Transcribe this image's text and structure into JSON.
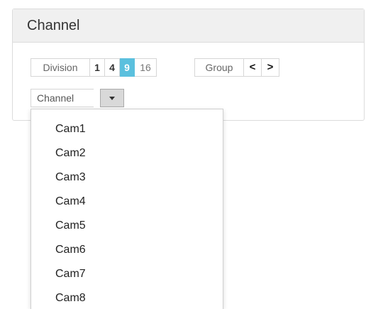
{
  "panel": {
    "title": "Channel"
  },
  "toolbar": {
    "division_label": "Division",
    "divisions": [
      {
        "label": "1",
        "active": false
      },
      {
        "label": "4",
        "active": false
      },
      {
        "label": "9",
        "active": true
      },
      {
        "label": "16",
        "active": false
      }
    ],
    "group_label": "Group",
    "prev_icon": "chevron-left-icon",
    "next_icon": "chevron-right-icon",
    "prev_glyph": "<",
    "next_glyph": ">"
  },
  "channel_select": {
    "label": "Channel",
    "caret_icon": "caret-down-icon"
  },
  "dropdown": {
    "items": [
      "Cam1",
      "Cam2",
      "Cam3",
      "Cam4",
      "Cam5",
      "Cam6",
      "Cam7",
      "Cam8"
    ]
  },
  "colors": {
    "accent": "#5bc0de",
    "heading_bg": "#f0f0f0",
    "border": "#dcdcdc"
  }
}
